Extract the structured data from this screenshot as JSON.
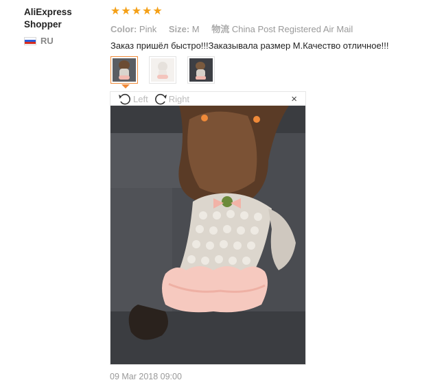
{
  "reviewer": {
    "name_line1": "AliExpress",
    "name_line2": "Shopper",
    "country": "RU"
  },
  "review": {
    "rating": 5,
    "stars": [
      "★",
      "★",
      "★",
      "★",
      "★"
    ],
    "color_key": "Color:",
    "color_value": "Pink",
    "size_key": "Size:",
    "size_value": "M",
    "shipping_key": "物流",
    "shipping_value": "China Post Registered Air Mail",
    "feedback": "Заказ пришёл быстро!!!Заказывала размер М.Качество отличное!!!",
    "date": "09 Mar 2018 09:00"
  },
  "viewer": {
    "rotate_left": "Left",
    "rotate_right": "Right",
    "close": "×"
  },
  "colors": {
    "star": "#f4a017",
    "accent": "#f08a39",
    "muted": "#999999"
  }
}
